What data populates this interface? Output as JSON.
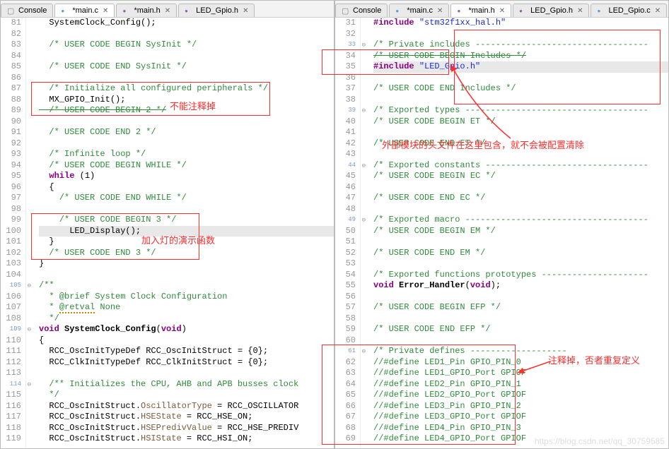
{
  "left": {
    "tabs": [
      {
        "label": "Console"
      },
      {
        "label": "*main.c",
        "dirty": true,
        "active": true,
        "closable": true
      },
      {
        "label": "*main.h",
        "dirty": true,
        "closable": true
      },
      {
        "label": "LED_Gpio.h",
        "closable": true
      }
    ],
    "startLine": 81,
    "lines": [
      {
        "n": 81,
        "seg": [
          {
            "t": "  SystemClock_Config();"
          }
        ]
      },
      {
        "n": 82,
        "seg": []
      },
      {
        "n": 83,
        "seg": [
          {
            "t": "  /* USER CODE BEGIN SysInit */",
            "c": "cmt"
          }
        ]
      },
      {
        "n": 84,
        "seg": []
      },
      {
        "n": 85,
        "seg": [
          {
            "t": "  /* USER CODE END SysInit */",
            "c": "cmt"
          }
        ]
      },
      {
        "n": 86,
        "seg": []
      },
      {
        "n": 87,
        "seg": [
          {
            "t": "  /* Initialize all configured peripherals */",
            "c": "cmt"
          }
        ]
      },
      {
        "n": 88,
        "seg": [
          {
            "t": "  MX_GPIO_Init();"
          }
        ]
      },
      {
        "n": 89,
        "seg": [
          {
            "t": "  /* USER CODE BEGIN 2 */",
            "c": "cmt strike"
          }
        ]
      },
      {
        "n": 90,
        "seg": []
      },
      {
        "n": 91,
        "seg": [
          {
            "t": "  /* USER CODE END 2 */",
            "c": "cmt"
          }
        ]
      },
      {
        "n": 92,
        "seg": []
      },
      {
        "n": 93,
        "seg": [
          {
            "t": "  /* Infinite loop */",
            "c": "cmt"
          }
        ]
      },
      {
        "n": 94,
        "seg": [
          {
            "t": "  /* USER CODE BEGIN WHILE */",
            "c": "cmt"
          }
        ]
      },
      {
        "n": 95,
        "seg": [
          {
            "t": "  ",
            "c": ""
          },
          {
            "t": "while",
            "c": "kw"
          },
          {
            "t": " (1)"
          }
        ]
      },
      {
        "n": 96,
        "seg": [
          {
            "t": "  {"
          }
        ]
      },
      {
        "n": 97,
        "seg": [
          {
            "t": "    /* USER CODE END WHILE */",
            "c": "cmt"
          }
        ]
      },
      {
        "n": 98,
        "seg": []
      },
      {
        "n": 99,
        "seg": [
          {
            "t": "    /* USER CODE BEGIN 3 */",
            "c": "cmt"
          }
        ]
      },
      {
        "n": 100,
        "hl": true,
        "seg": [
          {
            "t": "      LED_Display();"
          }
        ]
      },
      {
        "n": 101,
        "seg": [
          {
            "t": "  }"
          }
        ]
      },
      {
        "n": 102,
        "seg": [
          {
            "t": "  /* USER CODE END 3 */",
            "c": "cmt"
          }
        ]
      },
      {
        "n": 103,
        "seg": [
          {
            "t": "}"
          }
        ]
      },
      {
        "n": 104,
        "seg": []
      },
      {
        "n": 105,
        "decr": true,
        "seg": [
          {
            "t": "/**",
            "c": "cmt"
          }
        ]
      },
      {
        "n": 106,
        "seg": [
          {
            "t": "  * @brief System Clock Configuration",
            "c": "cmt"
          }
        ]
      },
      {
        "n": 107,
        "seg": [
          {
            "t": "  * ",
            "c": "cmt"
          },
          {
            "t": "@retval",
            "c": "cmt underline-err"
          },
          {
            "t": " None",
            "c": "cmt"
          }
        ]
      },
      {
        "n": 108,
        "seg": [
          {
            "t": "  */",
            "c": "cmt"
          }
        ]
      },
      {
        "n": 109,
        "decr": true,
        "seg": [
          {
            "t": "void",
            "c": "kw"
          },
          {
            "t": " "
          },
          {
            "t": "SystemClock_Config",
            "c": "fn"
          },
          {
            "t": "("
          },
          {
            "t": "void",
            "c": "kw"
          },
          {
            "t": ")"
          }
        ]
      },
      {
        "n": 110,
        "seg": [
          {
            "t": "{"
          }
        ]
      },
      {
        "n": 111,
        "seg": [
          {
            "t": "  RCC_OscInitTypeDef RCC_OscInitStruct = {0};"
          }
        ]
      },
      {
        "n": 112,
        "seg": [
          {
            "t": "  RCC_ClkInitTypeDef RCC_ClkInitStruct = {0};"
          }
        ]
      },
      {
        "n": 113,
        "seg": []
      },
      {
        "n": 114,
        "decr": true,
        "seg": [
          {
            "t": "  /** Initializes the CPU, AHB and APB busses clock",
            "c": "cmt"
          }
        ]
      },
      {
        "n": 115,
        "seg": [
          {
            "t": "  */",
            "c": "cmt"
          }
        ]
      },
      {
        "n": 116,
        "seg": [
          {
            "t": "  RCC_OscInitStruct."
          },
          {
            "t": "OscillatorType",
            "c": "typ"
          },
          {
            "t": " = RCC_OSCILLATOR"
          }
        ]
      },
      {
        "n": 117,
        "seg": [
          {
            "t": "  RCC_OscInitStruct."
          },
          {
            "t": "HSEState",
            "c": "typ"
          },
          {
            "t": " = RCC_HSE_ON;"
          }
        ]
      },
      {
        "n": 118,
        "seg": [
          {
            "t": "  RCC_OscInitStruct."
          },
          {
            "t": "HSEPredivValue",
            "c": "typ"
          },
          {
            "t": " = RCC_HSE_PREDIV"
          }
        ]
      },
      {
        "n": 119,
        "seg": [
          {
            "t": "  RCC_OscInitStruct."
          },
          {
            "t": "HSIState",
            "c": "typ"
          },
          {
            "t": " = RCC_HSI_ON;"
          }
        ]
      }
    ]
  },
  "right": {
    "tabs": [
      {
        "label": "Console"
      },
      {
        "label": "*main.c",
        "dirty": true,
        "closable": true
      },
      {
        "label": "*main.h",
        "dirty": true,
        "active": true,
        "closable": true
      },
      {
        "label": "LED_Gpio.h",
        "closable": true
      },
      {
        "label": "LED_Gpio.c",
        "closable": true
      }
    ],
    "lines": [
      {
        "n": 31,
        "seg": [
          {
            "t": "#include ",
            "c": "kw"
          },
          {
            "t": "\"stm32f1xx_hal.h\"",
            "c": "str"
          }
        ]
      },
      {
        "n": 32,
        "seg": []
      },
      {
        "n": 33,
        "decr": true,
        "seg": [
          {
            "t": "/* Private includes ----------------------------------",
            "c": "cmt"
          }
        ]
      },
      {
        "n": 34,
        "seg": [
          {
            "t": "/* USER CODE BEGIN Includes */",
            "c": "cmt strike"
          }
        ]
      },
      {
        "n": 35,
        "hl": true,
        "seg": [
          {
            "t": "#include ",
            "c": "kw"
          },
          {
            "t": "\"LED_Gpio.h\"",
            "c": "str"
          }
        ]
      },
      {
        "n": 36,
        "seg": []
      },
      {
        "n": 37,
        "seg": [
          {
            "t": "/* USER CODE END Includes */",
            "c": "cmt"
          }
        ]
      },
      {
        "n": 38,
        "seg": []
      },
      {
        "n": 39,
        "decr": true,
        "seg": [
          {
            "t": "/* Exported types ------------------------------------",
            "c": "cmt"
          }
        ]
      },
      {
        "n": 40,
        "seg": [
          {
            "t": "/* USER CODE BEGIN ET */",
            "c": "cmt"
          }
        ]
      },
      {
        "n": 41,
        "seg": []
      },
      {
        "n": 42,
        "seg": [
          {
            "t": "/* USER CODE END ET */",
            "c": "cmt"
          }
        ]
      },
      {
        "n": 43,
        "seg": []
      },
      {
        "n": 44,
        "decr": true,
        "seg": [
          {
            "t": "/* Exported constants --------------------------------",
            "c": "cmt"
          }
        ]
      },
      {
        "n": 45,
        "seg": [
          {
            "t": "/* USER CODE BEGIN EC */",
            "c": "cmt"
          }
        ]
      },
      {
        "n": 46,
        "seg": []
      },
      {
        "n": 47,
        "seg": [
          {
            "t": "/* USER CODE END EC */",
            "c": "cmt"
          }
        ]
      },
      {
        "n": 48,
        "seg": []
      },
      {
        "n": 49,
        "decr": true,
        "seg": [
          {
            "t": "/* Exported macro ------------------------------------",
            "c": "cmt"
          }
        ]
      },
      {
        "n": 50,
        "seg": [
          {
            "t": "/* USER CODE BEGIN EM */",
            "c": "cmt"
          }
        ]
      },
      {
        "n": 51,
        "seg": []
      },
      {
        "n": 52,
        "seg": [
          {
            "t": "/* USER CODE END EM */",
            "c": "cmt"
          }
        ]
      },
      {
        "n": 53,
        "seg": []
      },
      {
        "n": 54,
        "seg": [
          {
            "t": "/* Exported functions prototypes ---------------------",
            "c": "cmt"
          }
        ]
      },
      {
        "n": 55,
        "seg": [
          {
            "t": "void",
            "c": "kw"
          },
          {
            "t": " "
          },
          {
            "t": "Error_Handler",
            "c": "fn"
          },
          {
            "t": "("
          },
          {
            "t": "void",
            "c": "kw"
          },
          {
            "t": ");"
          }
        ]
      },
      {
        "n": 56,
        "seg": []
      },
      {
        "n": 57,
        "seg": [
          {
            "t": "/* USER CODE BEGIN EFP */",
            "c": "cmt"
          }
        ]
      },
      {
        "n": 58,
        "seg": []
      },
      {
        "n": 59,
        "seg": [
          {
            "t": "/* USER CODE END EFP */",
            "c": "cmt"
          }
        ]
      },
      {
        "n": 60,
        "seg": []
      },
      {
        "n": 61,
        "decr": true,
        "seg": [
          {
            "t": "/* Private defines -------------------",
            "c": "cmt"
          }
        ]
      },
      {
        "n": 62,
        "seg": [
          {
            "t": "//#define LED1_Pin GPIO_PIN_0",
            "c": "cmt"
          }
        ]
      },
      {
        "n": 63,
        "seg": [
          {
            "t": "//#define LED1_GPIO_Port GPIOF",
            "c": "cmt"
          }
        ]
      },
      {
        "n": 64,
        "seg": [
          {
            "t": "//#define LED2_Pin GPIO_PIN_1",
            "c": "cmt"
          }
        ]
      },
      {
        "n": 65,
        "seg": [
          {
            "t": "//#define LED2_GPIO_Port GPIOF",
            "c": "cmt"
          }
        ]
      },
      {
        "n": 66,
        "seg": [
          {
            "t": "//#define LED3_Pin GPIO_PIN_2",
            "c": "cmt"
          }
        ]
      },
      {
        "n": 67,
        "seg": [
          {
            "t": "//#define LED3_GPIO_Port GPIOF",
            "c": "cmt"
          }
        ]
      },
      {
        "n": 68,
        "seg": [
          {
            "t": "//#define LED4_Pin GPIO_PIN_3",
            "c": "cmt"
          }
        ]
      },
      {
        "n": 69,
        "seg": [
          {
            "t": "//#define LED4_GPIO_Port GPIOF",
            "c": "cmt"
          }
        ]
      }
    ]
  },
  "annotations": {
    "a1": "不能注释掉",
    "a2": "加入灯的演示函数",
    "a3": "外部模块的头文件在这里包含，就不会被配置清除",
    "a4": "注释掉，否者重复定义"
  },
  "watermark": "https://blog.csdn.net/qq_30759585"
}
